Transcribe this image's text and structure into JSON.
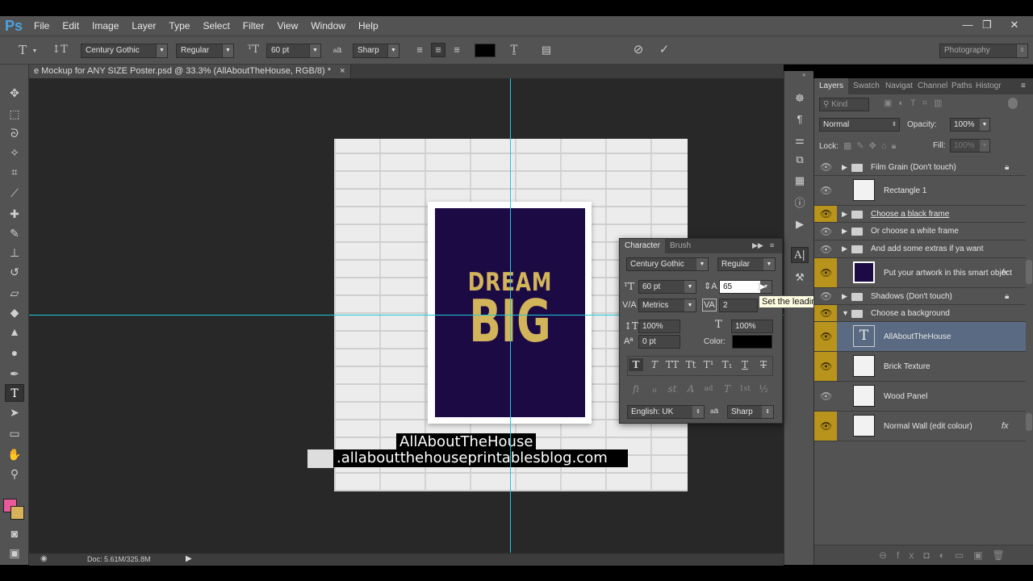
{
  "app": {
    "logo": "Ps"
  },
  "menu": [
    "File",
    "Edit",
    "Image",
    "Layer",
    "Type",
    "Select",
    "Filter",
    "View",
    "Window",
    "Help"
  ],
  "window_controls": [
    "—",
    "❐",
    "✕"
  ],
  "options": {
    "font_family": "Century Gothic",
    "font_style": "Regular",
    "font_size": "60 pt",
    "aa_label": "a",
    "antialias": "Sharp",
    "workspace": "Photography",
    "text_color": "#000000"
  },
  "document_tab": {
    "title": "e Mockup for ANY SIZE Poster.psd @ 33.3% (AllAboutTheHouse, RGB/8) *",
    "close": "×"
  },
  "poster": {
    "line1": "DREAM",
    "line2": "BIG"
  },
  "watermark": {
    "line1": "AllAboutTheHouse",
    "line2": ".allaboutthehouseprintablesblog.com"
  },
  "status": {
    "doc": "Doc: 5.61M/325.8M"
  },
  "character": {
    "tabs": [
      "Character",
      "Brush"
    ],
    "font_family": "Century Gothic",
    "font_style": "Regular",
    "size": "60 pt",
    "leading": "65",
    "kerning": "Metrics",
    "tracking": "2",
    "vscale": "100%",
    "hscale": "100%",
    "baseline": "0 pt",
    "color_label": "Color:",
    "color": "#000000",
    "language": "English: UK",
    "aa_label": "a",
    "antialias": "Sharp",
    "type_buttons": [
      "T",
      "T",
      "TT",
      "Tt",
      "T¹",
      "T₁",
      "T",
      "T"
    ],
    "opentype_buttons": [
      "fi",
      "ℴ",
      "st",
      "A",
      "ad",
      "T",
      "1st",
      "½"
    ]
  },
  "tooltip": "Set the leading",
  "layers_panel": {
    "tabs": [
      "Layers",
      "Swatch",
      "Navigat",
      "Channel",
      "Paths",
      "Histogr"
    ],
    "filter": "Kind",
    "blend_mode": "Normal",
    "opacity_label": "Opacity:",
    "opacity": "100%",
    "lock_label": "Lock:",
    "fill_label": "Fill:",
    "fill": "100%",
    "layers": [
      {
        "name": "Film Grain (Don't touch)",
        "type": "group",
        "visible": false,
        "locked": true
      },
      {
        "name": "Rectangle 1",
        "type": "shape",
        "visible": false
      },
      {
        "name": "Choose a black frame",
        "type": "group",
        "visible": true
      },
      {
        "name": "Or choose a white frame",
        "type": "group",
        "visible": false
      },
      {
        "name": "And add some extras if ya want",
        "type": "group",
        "visible": false
      },
      {
        "name": "Put your artwork in this smart object",
        "type": "smart",
        "visible": true,
        "fx": true
      },
      {
        "name": "Shadows (Don't touch)",
        "type": "group",
        "visible": false,
        "locked": true
      },
      {
        "name": "Choose a background",
        "type": "group-open",
        "visible": true
      },
      {
        "name": "AllAboutTheHouse",
        "type": "text",
        "visible": true,
        "selected": true
      },
      {
        "name": "Brick Texture",
        "type": "pixel",
        "visible": true
      },
      {
        "name": "Wood Panel",
        "type": "pixel",
        "visible": false
      },
      {
        "name": "Normal Wall (edit colour)",
        "type": "smart",
        "visible": true,
        "fx": true
      }
    ]
  },
  "colors": {
    "foreground": "#e85a9b",
    "background": "#d8b25a",
    "guide": "#22c8d6",
    "accent": "#b8941c",
    "poster_bg": "#1c0a45",
    "poster_text": "#d2b45a"
  }
}
